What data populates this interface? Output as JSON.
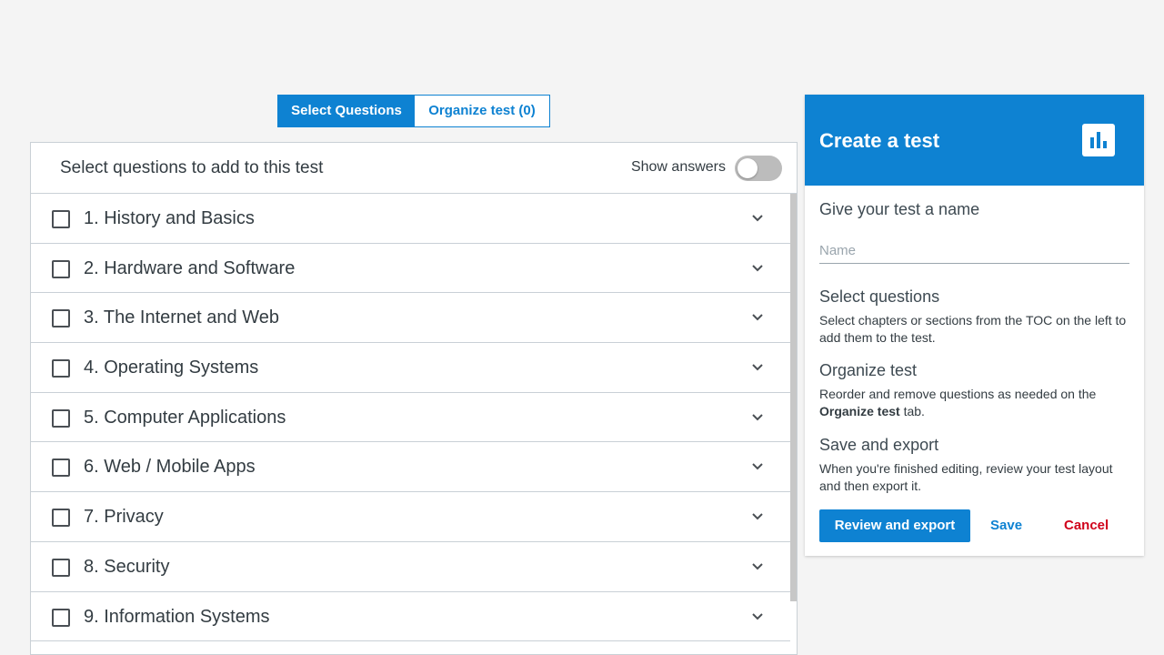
{
  "tabs": {
    "select_questions": "Select Questions",
    "organize_test": "Organize test (0)"
  },
  "left": {
    "title": "Select questions to add to this test",
    "show_answers_label": "Show answers",
    "show_answers_on": false,
    "chapters": [
      {
        "label": "1. History and Basics"
      },
      {
        "label": "2. Hardware and Software"
      },
      {
        "label": "3. The Internet and Web"
      },
      {
        "label": "4. Operating Systems"
      },
      {
        "label": "5. Computer Applications"
      },
      {
        "label": "6. Web / Mobile Apps"
      },
      {
        "label": "7. Privacy"
      },
      {
        "label": "8. Security"
      },
      {
        "label": "9. Information Systems"
      }
    ]
  },
  "right": {
    "title": "Create a test",
    "icon": "bar-chart-icon",
    "name_heading": "Give your test a name",
    "name_placeholder": "Name",
    "name_value": "",
    "select_heading": "Select questions",
    "select_text": "Select chapters or sections from the TOC on the left to add them to the test.",
    "organize_heading": "Organize test",
    "organize_text_before": "Reorder and remove questions as needed on the ",
    "organize_text_bold": "Organize test",
    "organize_text_after": " tab.",
    "save_heading": "Save and export",
    "save_text": "When you're finished editing, review your test layout and then export it.",
    "review_button": "Review and export",
    "save_button": "Save",
    "cancel_button": "Cancel"
  },
  "colors": {
    "accent": "#0e82d2",
    "cancel": "#d0021b",
    "background": "#f4f4f4"
  }
}
